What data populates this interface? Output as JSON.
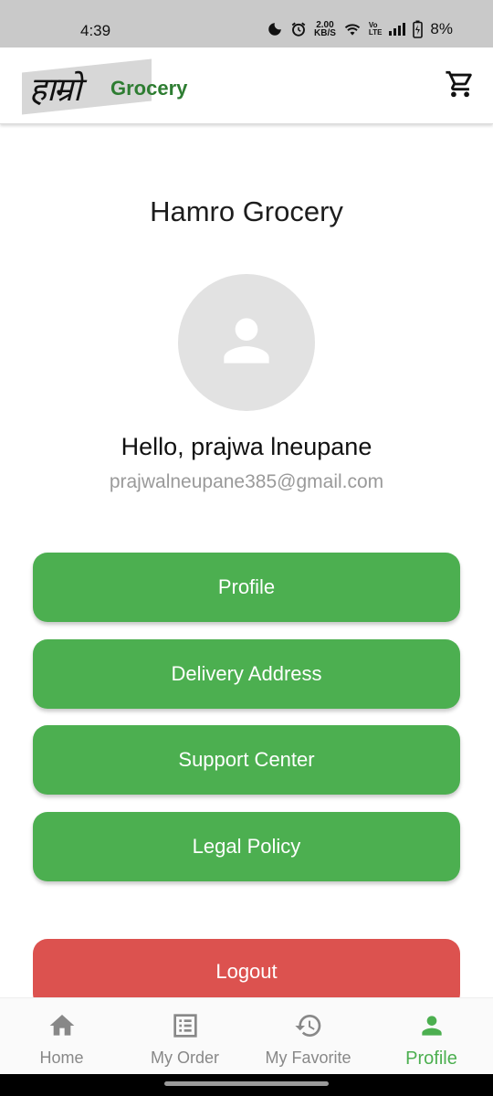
{
  "status_bar": {
    "time": "4:39",
    "speed_value": "2.00",
    "speed_unit": "KB/S",
    "volte_top": "Vo",
    "volte_bottom": "LTE",
    "battery": "8%"
  },
  "app_bar": {
    "logo_script": "हाम्रो",
    "logo_word": "Grocery",
    "cart_icon": "cart-icon"
  },
  "profile": {
    "title": "Hamro Grocery",
    "avatar_icon": "person-icon",
    "greeting": "Hello, prajwa lneupane",
    "email": "prajwalneupane385@gmail.com"
  },
  "menu": {
    "items": [
      {
        "label": "Profile"
      },
      {
        "label": "Delivery Address"
      },
      {
        "label": "Support Center"
      },
      {
        "label": "Legal Policy"
      }
    ],
    "logout": "Logout"
  },
  "bottom_nav": {
    "items": [
      {
        "label": "Home",
        "icon": "home-icon",
        "active": false
      },
      {
        "label": "My Order",
        "icon": "order-list-icon",
        "active": false
      },
      {
        "label": "My Favorite",
        "icon": "history-icon",
        "active": false
      },
      {
        "label": "Profile",
        "icon": "person-icon",
        "active": true
      }
    ]
  },
  "colors": {
    "primary": "#4caf50",
    "logout": "#dc524f",
    "status_bar": "#c9c9c9",
    "inactive_nav": "#888888"
  }
}
